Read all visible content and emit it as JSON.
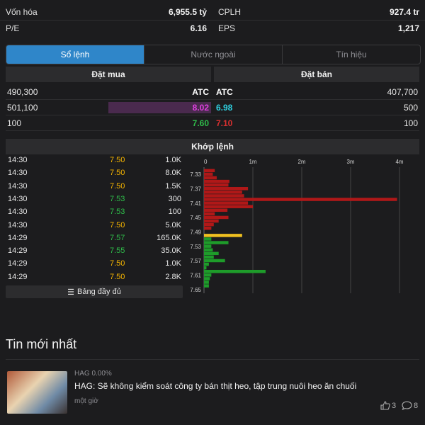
{
  "stats": {
    "row1": [
      {
        "label": "Vốn hóa",
        "value": "6,955.5 tỷ"
      },
      {
        "label": "CPLH",
        "value": "927.4 tr"
      }
    ],
    "row2": [
      {
        "label": "P/E",
        "value": "6.16"
      },
      {
        "label": "EPS",
        "value": "1,217"
      }
    ]
  },
  "tabs": [
    "Sổ lệnh",
    "Nước ngoài",
    "Tín hiệu"
  ],
  "orderbook": {
    "buy_header": "Đặt mua",
    "sell_header": "Đặt bán",
    "rows": [
      {
        "buy_vol": "490,300",
        "buy_price": "ATC",
        "sell_price": "ATC",
        "sell_vol": "407,700",
        "buy_color": "#ffffff",
        "sell_color": "#ffffff"
      },
      {
        "buy_vol": "501,100",
        "buy_price": "8.02",
        "sell_price": "6.98",
        "sell_vol": "500",
        "buy_color": "#e040e0",
        "sell_color": "#2fd0e0"
      },
      {
        "buy_vol": "100",
        "buy_price": "7.60",
        "sell_price": "7.10",
        "sell_vol": "100",
        "buy_color": "#2fbd4a",
        "sell_color": "#d93030"
      }
    ]
  },
  "matched": {
    "header": "Khớp lệnh",
    "trades": [
      {
        "time": "14:30",
        "price": "7.50",
        "vol": "1.0K",
        "color": "yellow"
      },
      {
        "time": "14:30",
        "price": "7.50",
        "vol": "8.0K",
        "color": "yellow"
      },
      {
        "time": "14:30",
        "price": "7.50",
        "vol": "1.5K",
        "color": "yellow"
      },
      {
        "time": "14:30",
        "price": "7.53",
        "vol": "300",
        "color": "green"
      },
      {
        "time": "14:30",
        "price": "7.53",
        "vol": "100",
        "color": "green"
      },
      {
        "time": "14:30",
        "price": "7.50",
        "vol": "5.0K",
        "color": "yellow"
      },
      {
        "time": "14:29",
        "price": "7.57",
        "vol": "165.0K",
        "color": "green"
      },
      {
        "time": "14:29",
        "price": "7.55",
        "vol": "35.0K",
        "color": "green"
      },
      {
        "time": "14:29",
        "price": "7.50",
        "vol": "1.0K",
        "color": "yellow"
      },
      {
        "time": "14:29",
        "price": "7.50",
        "vol": "2.8K",
        "color": "yellow"
      }
    ],
    "full_button": "Bảng đầy đủ"
  },
  "chart_data": {
    "type": "bar",
    "orientation": "horizontal",
    "x_ticks": [
      "0",
      "1m",
      "2m",
      "3m",
      "4m"
    ],
    "xlim": [
      0,
      4000000
    ],
    "y_ticks": [
      "7.33",
      "7.37",
      "7.41",
      "7.45",
      "7.49",
      "7.53",
      "7.57",
      "7.61",
      "7.65"
    ],
    "ylim": [
      7.31,
      7.66
    ],
    "bars": [
      {
        "price": 7.32,
        "value": 220000,
        "color": "#b01818"
      },
      {
        "price": 7.33,
        "value": 180000,
        "color": "#b01818"
      },
      {
        "price": 7.34,
        "value": 260000,
        "color": "#b01818"
      },
      {
        "price": 7.35,
        "value": 520000,
        "color": "#b01818"
      },
      {
        "price": 7.36,
        "value": 500000,
        "color": "#b01818"
      },
      {
        "price": 7.37,
        "value": 900000,
        "color": "#b01818"
      },
      {
        "price": 7.38,
        "value": 780000,
        "color": "#b01818"
      },
      {
        "price": 7.39,
        "value": 820000,
        "color": "#b01818"
      },
      {
        "price": 7.4,
        "value": 3950000,
        "color": "#b01818"
      },
      {
        "price": 7.41,
        "value": 900000,
        "color": "#b01818"
      },
      {
        "price": 7.42,
        "value": 1000000,
        "color": "#b01818"
      },
      {
        "price": 7.43,
        "value": 480000,
        "color": "#b01818"
      },
      {
        "price": 7.44,
        "value": 220000,
        "color": "#b01818"
      },
      {
        "price": 7.45,
        "value": 500000,
        "color": "#b01818"
      },
      {
        "price": 7.46,
        "value": 300000,
        "color": "#b01818"
      },
      {
        "price": 7.47,
        "value": 200000,
        "color": "#b01818"
      },
      {
        "price": 7.48,
        "value": 150000,
        "color": "#b01818"
      },
      {
        "price": 7.5,
        "value": 780000,
        "color": "#f0c020"
      },
      {
        "price": 7.51,
        "value": 150000,
        "color": "#1e9c2a"
      },
      {
        "price": 7.52,
        "value": 500000,
        "color": "#1e9c2a"
      },
      {
        "price": 7.53,
        "value": 150000,
        "color": "#1e9c2a"
      },
      {
        "price": 7.54,
        "value": 180000,
        "color": "#1e9c2a"
      },
      {
        "price": 7.55,
        "value": 300000,
        "color": "#1e9c2a"
      },
      {
        "price": 7.56,
        "value": 200000,
        "color": "#1e9c2a"
      },
      {
        "price": 7.57,
        "value": 430000,
        "color": "#1e9c2a"
      },
      {
        "price": 7.58,
        "value": 100000,
        "color": "#1e9c2a"
      },
      {
        "price": 7.59,
        "value": 50000,
        "color": "#1e9c2a"
      },
      {
        "price": 7.6,
        "value": 1260000,
        "color": "#1e9c2a"
      },
      {
        "price": 7.61,
        "value": 150000,
        "color": "#1e9c2a"
      },
      {
        "price": 7.62,
        "value": 120000,
        "color": "#1e9c2a"
      },
      {
        "price": 7.63,
        "value": 100000,
        "color": "#1e9c2a"
      },
      {
        "price": 7.64,
        "value": 100000,
        "color": "#1e9c2a"
      }
    ]
  },
  "news": {
    "section_title": "Tin mới nhất",
    "item": {
      "tag": "HAG 0.00%",
      "headline": "HAG: Sẽ không kiểm soát công ty bán thịt heo, tập trung nuôi heo ăn chuối",
      "time": "một giờ",
      "likes": "3",
      "comments": "8"
    }
  }
}
